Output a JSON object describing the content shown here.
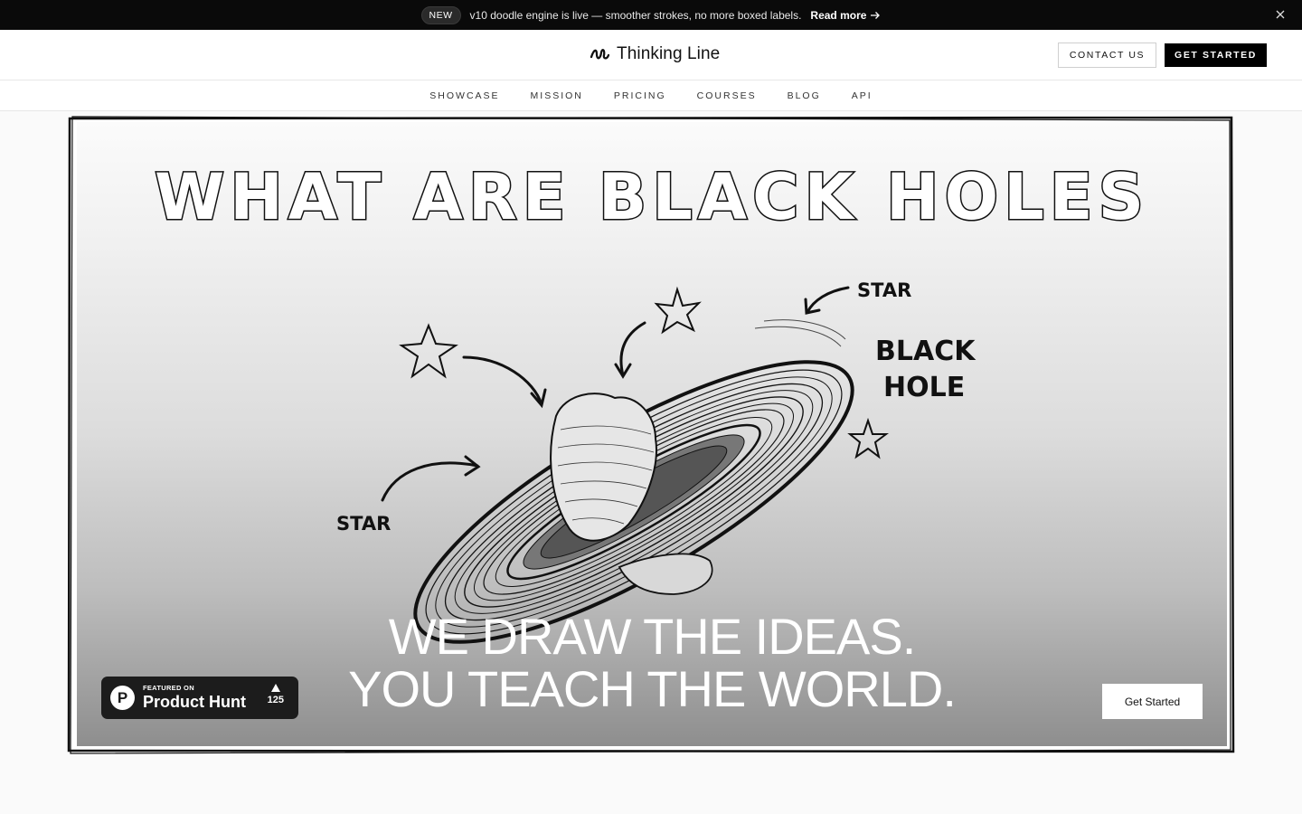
{
  "announcement": {
    "badge": "NEW",
    "message": "v10 doodle engine is live — smoother strokes, no more boxed labels.",
    "link_label": "Read more"
  },
  "header": {
    "brand": "Thinking Line",
    "contact_label": "CONTACT US",
    "get_started_label": "GET STARTED"
  },
  "nav": {
    "items": [
      {
        "label": "SHOWCASE"
      },
      {
        "label": "MISSION"
      },
      {
        "label": "PRICING"
      },
      {
        "label": "COURSES"
      },
      {
        "label": "BLOG"
      },
      {
        "label": "API"
      }
    ]
  },
  "hero": {
    "illustration_title": "WHAT ARE BLACK HOLES",
    "labels": {
      "star_top": "STAR",
      "black": "BLACK",
      "hole": "HOLE",
      "star_left": "STAR"
    },
    "headline_line1": "WE DRAW THE IDEAS.",
    "headline_line2": "YOU TEACH THE WORLD.",
    "cta_label": "Get Started"
  },
  "product_hunt": {
    "featured": "FEATURED ON",
    "name": "Product Hunt",
    "letter": "P",
    "votes": "125"
  },
  "colors": {
    "announcement_bg": "#0a0a0a",
    "accent": "#000000",
    "page_bg": "#fafafa"
  }
}
